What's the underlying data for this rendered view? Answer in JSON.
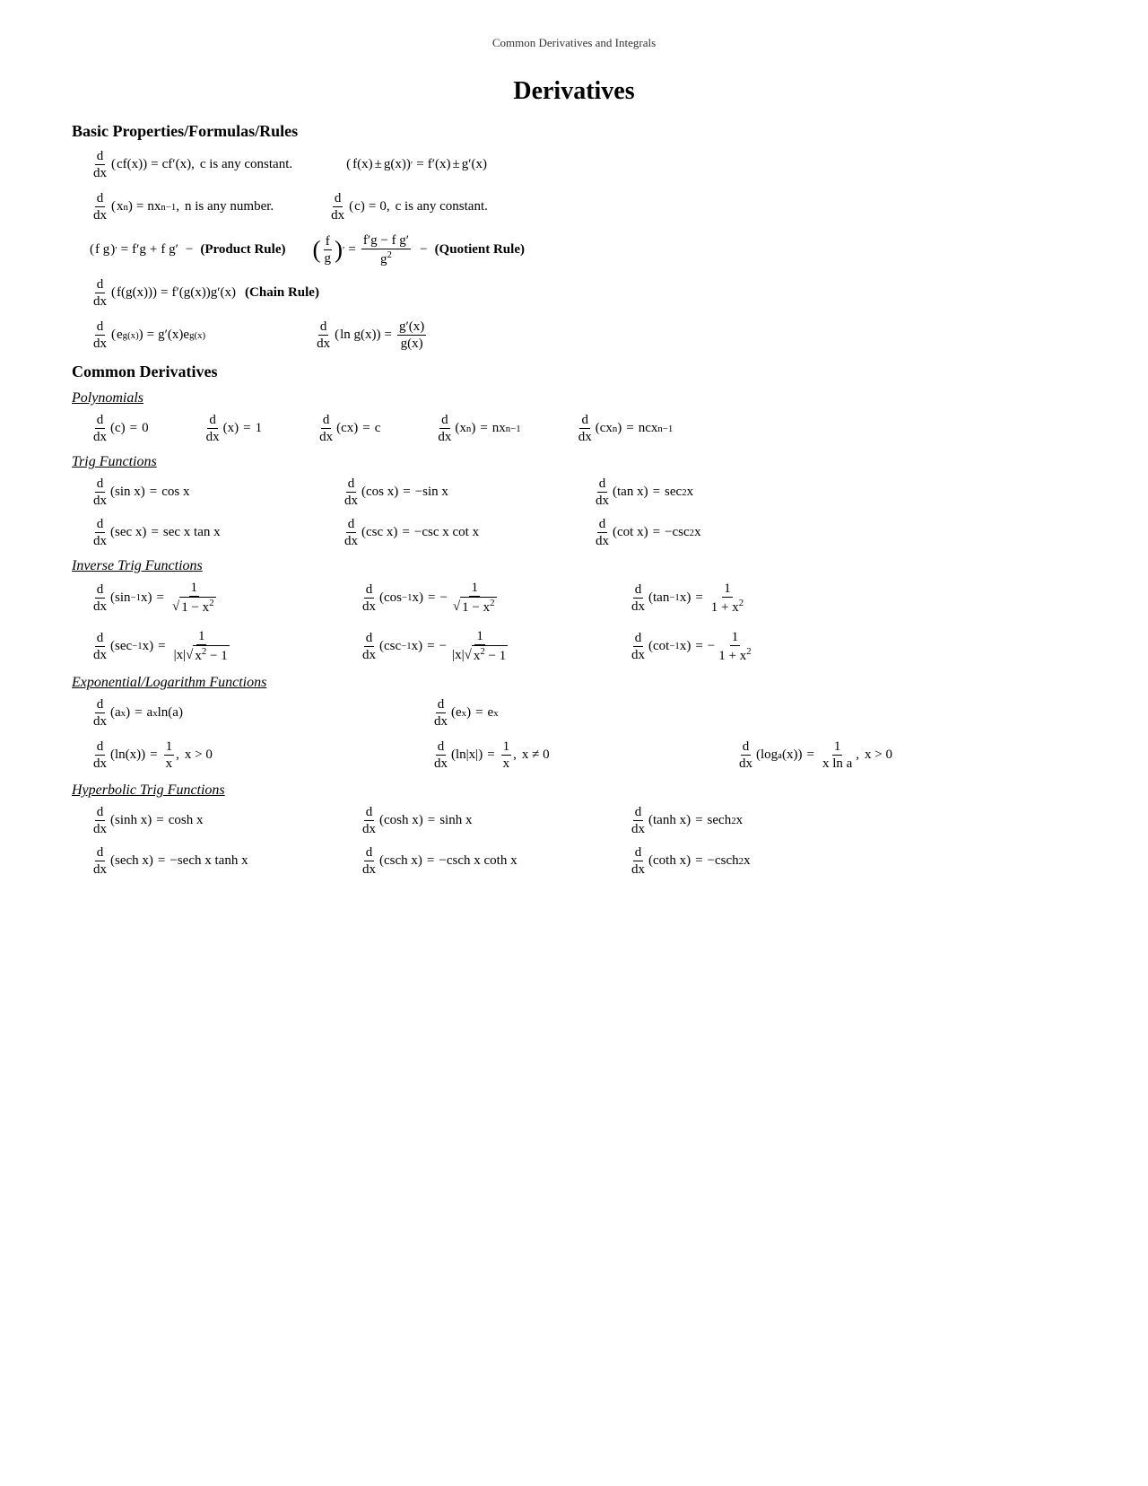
{
  "page": {
    "header": "Common Derivatives and Integrals",
    "title": "Derivatives",
    "sections": {
      "basic": {
        "title": "Basic Properties/Formulas/Rules"
      },
      "common": {
        "title": "Common Derivatives"
      },
      "polynomials": {
        "subtitle": "Polynomials"
      },
      "trig": {
        "subtitle": "Trig Functions"
      },
      "inverse_trig": {
        "subtitle": "Inverse Trig Functions"
      },
      "exp_log": {
        "subtitle": "Exponential/Logarithm Functions"
      },
      "hyp": {
        "subtitle": "Hyperbolic Trig Functions"
      }
    }
  }
}
